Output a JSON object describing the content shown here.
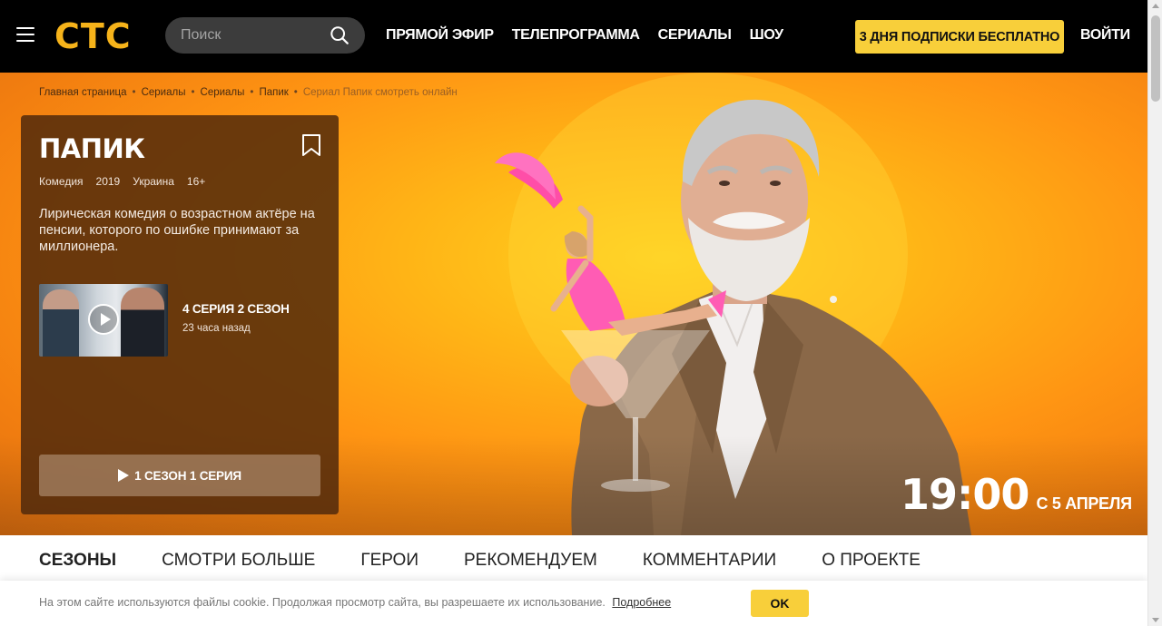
{
  "header": {
    "logo": "СТС",
    "search_placeholder": "Поиск",
    "nav": [
      "ПРЯМОЙ ЭФИР",
      "ТЕЛЕПРОГРАММА",
      "СЕРИАЛЫ",
      "ШОУ"
    ],
    "promo_button": "3 ДНЯ ПОДПИСКИ БЕСПЛАТНО",
    "login": "ВОЙТИ"
  },
  "breadcrumb": {
    "items": [
      "Главная страница",
      "Сериалы",
      "Сериалы",
      "Папик"
    ],
    "current": "Сериал Папик смотреть онлайн"
  },
  "show": {
    "title": "ПАПИК",
    "meta": [
      "Комедия",
      "2019",
      "Украина",
      "16+"
    ],
    "description": "Лирическая комедия о возрастном актёре на пенсии, которого по ошибке принимают за миллионера.",
    "latest_episode": {
      "title": "4 СЕРИЯ 2 СЕЗОН",
      "time": "23 часа назад"
    },
    "watch_button": "1 СЕЗОН 1 СЕРИЯ"
  },
  "schedule": {
    "time": "19:00",
    "date": "С 5 АПРЕЛЯ"
  },
  "tabs": [
    {
      "label": "СЕЗОНЫ",
      "active": true
    },
    {
      "label": "СМОТРИ БОЛЬШЕ",
      "active": false
    },
    {
      "label": "ГЕРОИ",
      "active": false
    },
    {
      "label": "РЕКОМЕНДУЕМ",
      "active": false
    },
    {
      "label": "КОММЕНТАРИИ",
      "active": false
    },
    {
      "label": "О ПРОЕКТЕ",
      "active": false
    }
  ],
  "cookie": {
    "text": "На этом сайте используются файлы cookie. Продолжая просмотр сайта, вы разрешаете их использование.",
    "link": "Подробнее",
    "ok": "OK"
  },
  "colors": {
    "accent": "#f8cf3a",
    "logo": "#f6b31a",
    "hero_orange": "#ff9513"
  },
  "icons": [
    "menu-icon",
    "search-icon",
    "bookmark-icon",
    "play-icon"
  ]
}
